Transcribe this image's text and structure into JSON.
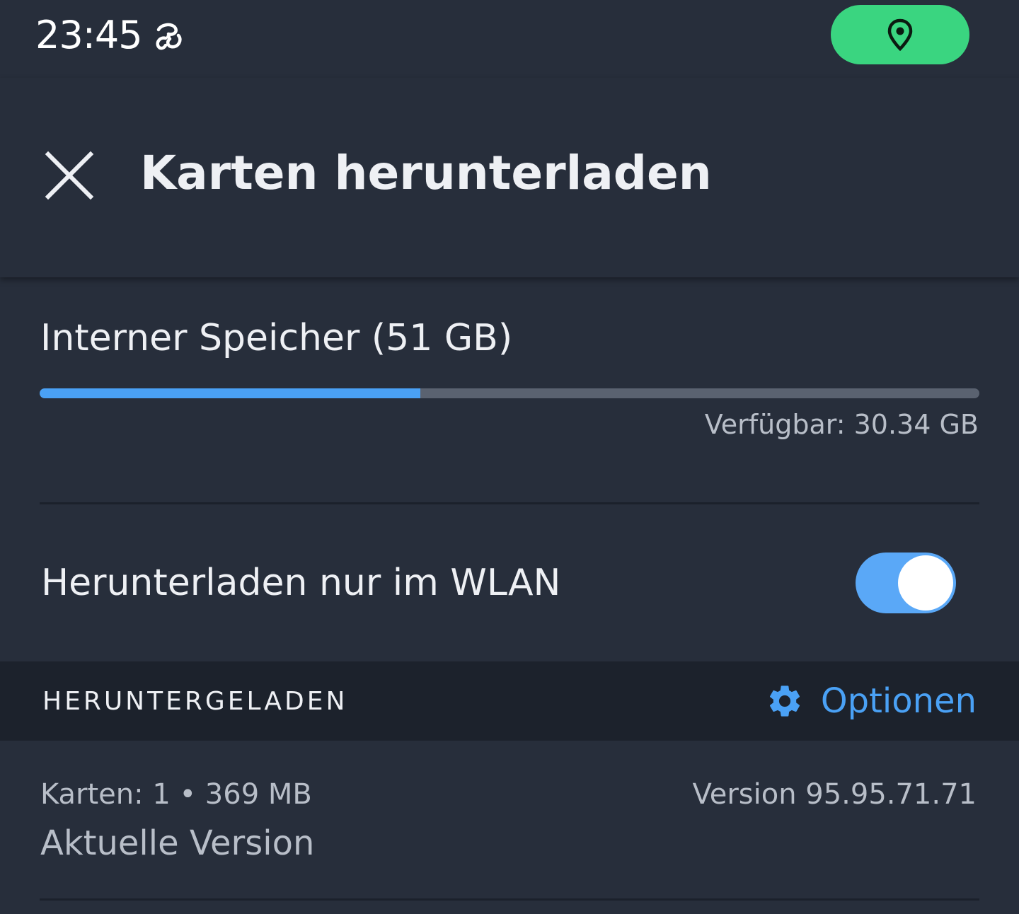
{
  "status_bar": {
    "time": "23:45",
    "notification_icon": "cast-swirl-icon",
    "location_indicator_color": "#3ad580",
    "location_icon": "location-pin-icon"
  },
  "app_bar": {
    "close_icon": "close-icon",
    "title": "Karten herunterladen"
  },
  "storage": {
    "title": "Interner Speicher (51 GB)",
    "used_fraction": 0.405,
    "available_label": "Verfügbar: 30.34 GB",
    "bar_color": "#4aa1f5"
  },
  "wifi_only": {
    "label": "Herunterladen nur im WLAN",
    "enabled": true
  },
  "downloaded": {
    "section_title": "HERUNTERGELADEN",
    "options_label": "Optionen",
    "options_icon": "gear-icon",
    "maps_count": "Karten: 1 • 369 MB",
    "version": "Version 95.95.71.71",
    "version_status": "Aktuelle Version"
  },
  "colors": {
    "background": "#272e3b",
    "accent": "#4aa1f5",
    "section_header": "#1c222c"
  }
}
